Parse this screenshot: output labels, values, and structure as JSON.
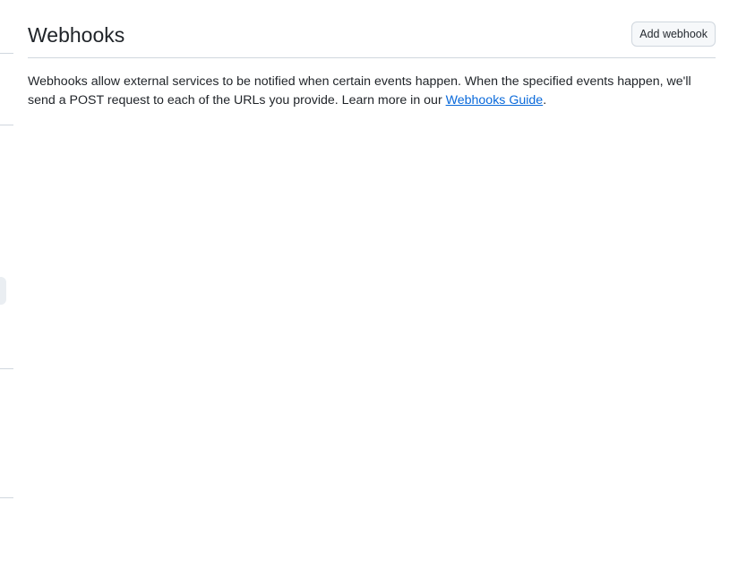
{
  "header": {
    "title": "Webhooks",
    "add_button_label": "Add webhook"
  },
  "description": {
    "text": "Webhooks allow external services to be notified when certain events happen. When the specified events happen, we'll send a POST request to each of the URLs you provide. Learn more in our ",
    "link_text": "Webhooks Guide",
    "suffix": "."
  },
  "colors": {
    "link": "#0969da",
    "border": "#d0d7de",
    "button_bg": "#f6f8fa",
    "text": "#1f2328"
  }
}
